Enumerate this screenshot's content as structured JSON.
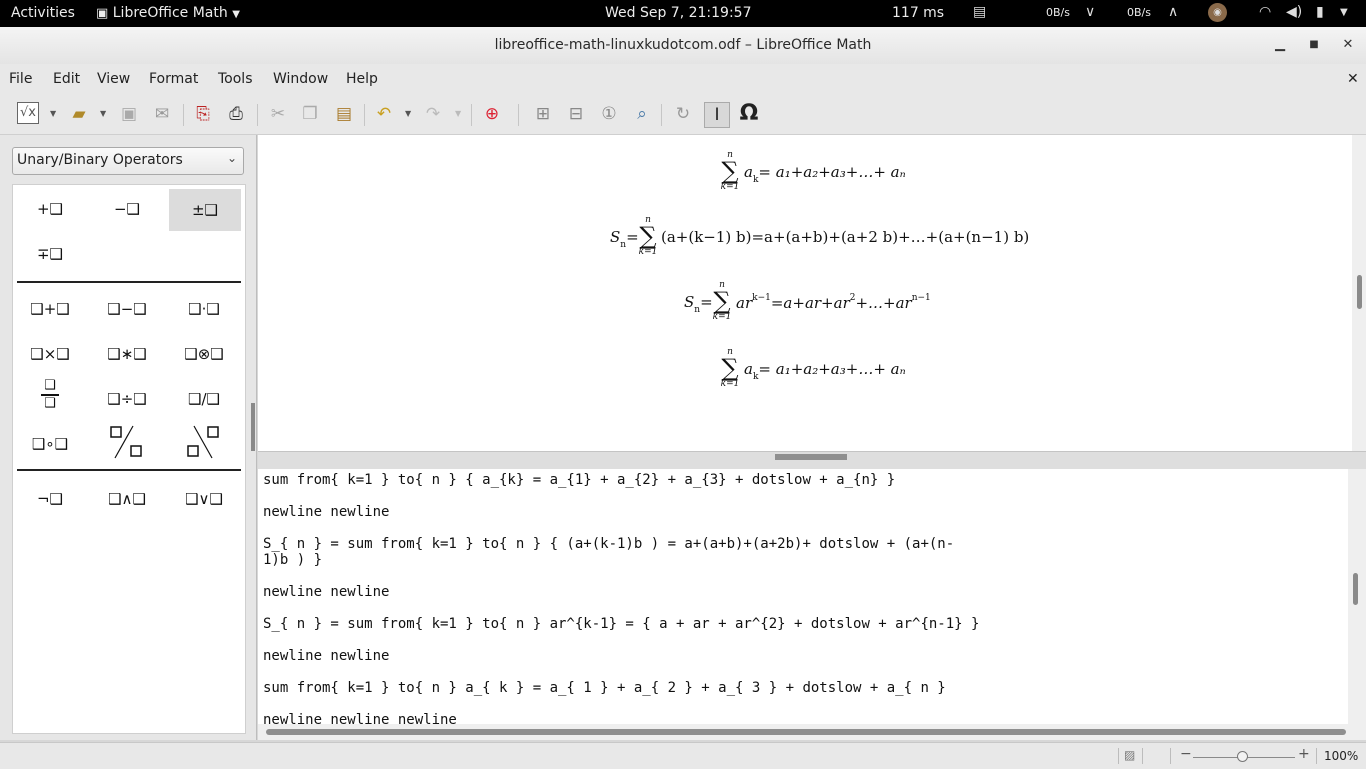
{
  "topbar": {
    "activities": "Activities",
    "app_menu": "LibreOffice Math",
    "clock": "Wed Sep  7, 21:19:57",
    "latency": "117 ms",
    "net_down": "0B/s",
    "net_up": "0B/s"
  },
  "window": {
    "title": "libreoffice-math-linuxkudotcom.odf – LibreOffice Math"
  },
  "menu": {
    "file": "File",
    "edit": "Edit",
    "view": "View",
    "format": "Format",
    "tools": "Tools",
    "window": "Window",
    "help": "Help"
  },
  "sidebar": {
    "category": "Unary/Binary Operators",
    "unary": [
      "+❑",
      "−❑",
      "±❑",
      "∓❑"
    ],
    "binary": [
      "❑+❑",
      "❑−❑",
      "❑·❑",
      "❑×❑",
      "❑∗❑",
      "❑⊗❑",
      "❑÷❑",
      "❑/❑",
      "❑∘❑"
    ],
    "logic": [
      "¬❑",
      "❑∧❑",
      "❑∨❑"
    ]
  },
  "formulas": {
    "f1": {
      "lhs": "a",
      "lhs_sub": "k",
      "rhs": "= a₁+a₂+a₃+…+ aₙ"
    },
    "f2": {
      "lhs": "S",
      "lhs_sub": "n",
      "rhs": "(a+(k−1) b)=a+(a+b)+(a+2 b)+…+(a+(n−1) b)"
    },
    "f3": {
      "lhs": "S",
      "lhs_sub": "n",
      "rhs_a": "ar",
      "rhs_a_sup": "k−1",
      "rhs_b": "=a+ar+ar",
      "rhs_b_sup": "2",
      "rhs_c": "+…+ar",
      "rhs_c_sup": "n−1"
    },
    "f4": {
      "lhs": "a",
      "lhs_sub": "k",
      "rhs": "= a₁+a₂+a₃+…+ aₙ"
    },
    "sum_upper": "n",
    "sum_lower": "k=1"
  },
  "commands": [
    "sum from{ k=1 } to{ n } { a_{k} = a_{1} + a_{2} + a_{3} + dotslow + a_{n} }",
    "newline newline",
    "S_{ n } = sum from{ k=1 } to{ n } { (a+(k-1)b ) = a+(a+b)+(a+2b)+ dotslow + (a+(n-",
    "1)b ) }",
    "newline newline",
    "S_{ n } = sum from{ k=1 } to{ n } ar^{k-1} = { a + ar + ar^{2} + dotslow + ar^{n-1} }",
    "newline newline",
    "sum from{ k=1 } to{ n } a_{ k } = a_{ 1 } + a_{ 2 } + a_{ 3 } + dotslow + a_{ n }",
    "newline newline newline"
  ],
  "status": {
    "zoom": "100%"
  },
  "zoom_level": 1.0
}
